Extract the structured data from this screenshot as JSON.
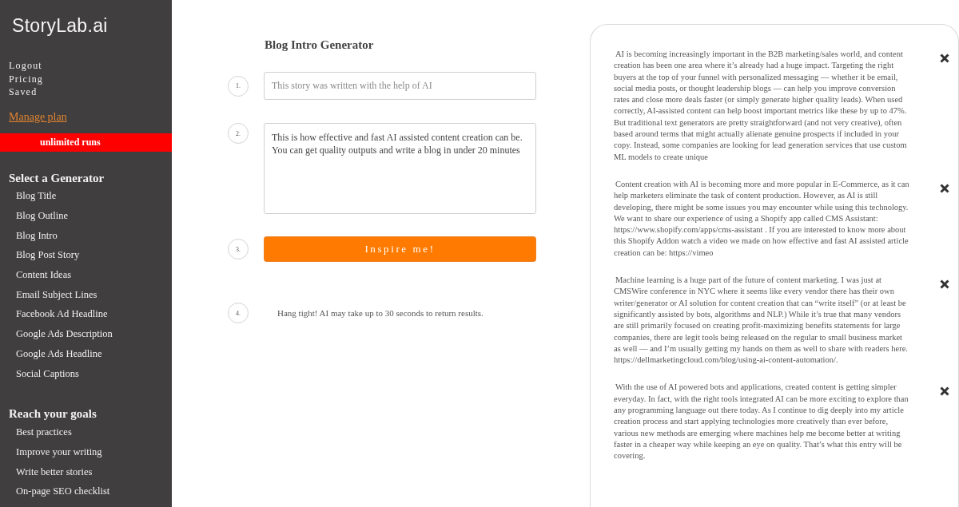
{
  "sidebar": {
    "logo": "StoryLab.ai",
    "account_links": [
      "Logout",
      "Pricing",
      "Saved"
    ],
    "manage_plan": "Manage plan",
    "plan_badge": "unlimited runs",
    "sections": [
      {
        "heading": "Select a Generator",
        "items": [
          "Blog Title",
          "Blog Outline",
          "Blog Intro",
          "Blog Post Story",
          "Content Ideas",
          "Email Subject Lines",
          "Facebook Ad Headline",
          "Google Ads Description",
          "Google Ads Headline",
          "Social Captions"
        ]
      },
      {
        "heading": "Reach your goals",
        "items": [
          "Best practices",
          "Improve your writing",
          "Write better stories",
          "On-page SEO checklist"
        ]
      }
    ]
  },
  "generator": {
    "title": "Blog Intro Generator",
    "steps": [
      {
        "number": "1.",
        "kind": "input",
        "placeholder": "This story was written with the help of AI"
      },
      {
        "number": "2.",
        "kind": "textarea",
        "value": "This is how effective and fast AI assisted content creation can be. You can get quality outputs and write a blog in under 20 minutes"
      },
      {
        "number": "3.",
        "kind": "button",
        "label": "Inspire me!"
      },
      {
        "number": "4.",
        "kind": "note",
        "text": "Hang tight! AI may take up to 30 seconds to return results."
      }
    ]
  },
  "results": [
    {
      "text": "AI is becoming increasingly important in the B2B marketing/sales world, and content creation has been one area where it’s already had a huge impact. Targeting the right buyers at the top of your funnel with personalized messaging — whether it be email, social media posts, or thought leadership blogs — can help you improve conversion rates and close more deals faster (or simply generate higher quality leads). When used correctly, AI-assisted content can help boost important metrics like these by up to 47%. But traditional text generators are pretty straightforward (and not very creative), often based around terms that might actually alienate genuine prospects if included in your copy. Instead, some companies are looking for lead generation services that use custom ML models to create unique"
    },
    {
      "text": "Content creation with AI is becoming more and more popular in E-Commerce, as it can help marketers eliminate the task of content production. However, as AI is still developing, there might be some issues you may encounter while using this technology. We want to share our experience of using a Shopify app called CMS Assistant: https://www.shopify.com/apps/cms-assistant . If you are interested to know more about this Shopify Addon watch a video we made on how effective and fast AI assisted article creation can be: https://vimeo"
    },
    {
      "text": "Machine learning is a huge part of the future of content marketing. I was just at CMSWire conference in NYC where it seems like every vendor there has their own writer/generator or AI solution for content creation that can “write itself” (or at least be significantly assisted by bots, algorithms and NLP.) While it’s true that many vendors are still primarily focused on creating profit-maximizing benefits statements for large companies, there are legit tools being released on the regular to small business market as well — and I’m usually getting my hands on them as well to share with readers here. https://dellmarketingcloud.com/blog/using-ai-content-automation/."
    },
    {
      "text": "With the use of AI powered bots and applications, created content is getting simpler everyday. In fact, with the right tools integrated AI can be more exciting to explore than any programming language out there today. As I continue to dig deeply into my article creation process and start applying technologies more creatively than ever before, various new methods are emerging where machines help me become better at writing faster in a cheaper way while keeping an eye on quality. That’s what this entry will be covering."
    }
  ]
}
